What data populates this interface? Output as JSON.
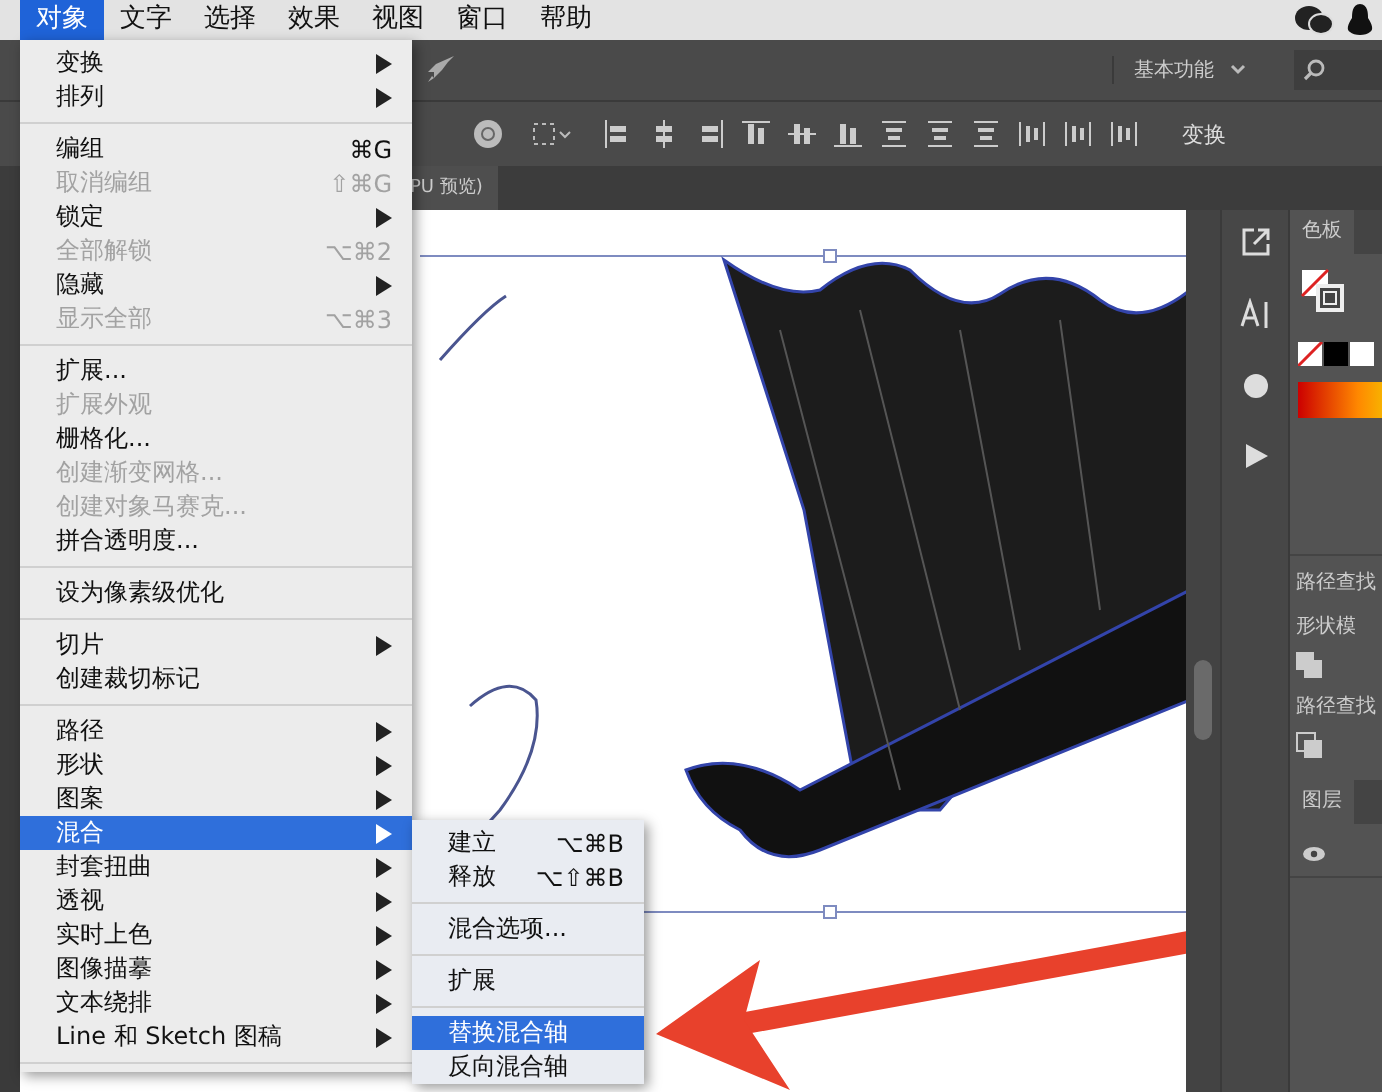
{
  "menubar": {
    "items": [
      {
        "label": "对象",
        "selected": true
      },
      {
        "label": "文字",
        "selected": false
      },
      {
        "label": "选择",
        "selected": false
      },
      {
        "label": "效果",
        "selected": false
      },
      {
        "label": "视图",
        "selected": false
      },
      {
        "label": "窗口",
        "selected": false
      },
      {
        "label": "帮助",
        "selected": false
      }
    ]
  },
  "menu": {
    "items": [
      {
        "kind": "item",
        "label": "变换",
        "submenu": true,
        "disabled": false,
        "selected": false
      },
      {
        "kind": "item",
        "label": "排列",
        "submenu": true,
        "disabled": false,
        "selected": false
      },
      {
        "kind": "separator"
      },
      {
        "kind": "item",
        "label": "编组",
        "shortcut": "⌘G",
        "submenu": false,
        "disabled": false,
        "selected": false
      },
      {
        "kind": "item",
        "label": "取消编组",
        "shortcut": "⇧⌘G",
        "submenu": false,
        "disabled": true,
        "selected": false
      },
      {
        "kind": "item",
        "label": "锁定",
        "submenu": true,
        "disabled": false,
        "selected": false
      },
      {
        "kind": "item",
        "label": "全部解锁",
        "shortcut": "⌥⌘2",
        "submenu": false,
        "disabled": true,
        "selected": false
      },
      {
        "kind": "item",
        "label": "隐藏",
        "submenu": true,
        "disabled": false,
        "selected": false
      },
      {
        "kind": "item",
        "label": "显示全部",
        "shortcut": "⌥⌘3",
        "submenu": false,
        "disabled": true,
        "selected": false
      },
      {
        "kind": "separator"
      },
      {
        "kind": "item",
        "label": "扩展...",
        "submenu": false,
        "disabled": false,
        "selected": false
      },
      {
        "kind": "item",
        "label": "扩展外观",
        "submenu": false,
        "disabled": true,
        "selected": false
      },
      {
        "kind": "item",
        "label": "栅格化...",
        "submenu": false,
        "disabled": false,
        "selected": false
      },
      {
        "kind": "item",
        "label": "创建渐变网格...",
        "submenu": false,
        "disabled": true,
        "selected": false
      },
      {
        "kind": "item",
        "label": "创建对象马赛克...",
        "submenu": false,
        "disabled": true,
        "selected": false
      },
      {
        "kind": "item",
        "label": "拼合透明度...",
        "submenu": false,
        "disabled": false,
        "selected": false
      },
      {
        "kind": "separator"
      },
      {
        "kind": "item",
        "label": "设为像素级优化",
        "submenu": false,
        "disabled": false,
        "selected": false
      },
      {
        "kind": "separator"
      },
      {
        "kind": "item",
        "label": "切片",
        "submenu": true,
        "disabled": false,
        "selected": false
      },
      {
        "kind": "item",
        "label": "创建裁切标记",
        "submenu": false,
        "disabled": false,
        "selected": false
      },
      {
        "kind": "separator"
      },
      {
        "kind": "item",
        "label": "路径",
        "submenu": true,
        "disabled": false,
        "selected": false
      },
      {
        "kind": "item",
        "label": "形状",
        "submenu": true,
        "disabled": false,
        "selected": false
      },
      {
        "kind": "item",
        "label": "图案",
        "submenu": true,
        "disabled": false,
        "selected": false
      },
      {
        "kind": "item",
        "label": "混合",
        "submenu": true,
        "disabled": false,
        "selected": true
      },
      {
        "kind": "item",
        "label": "封套扭曲",
        "submenu": true,
        "disabled": false,
        "selected": false
      },
      {
        "kind": "item",
        "label": "透视",
        "submenu": true,
        "disabled": false,
        "selected": false
      },
      {
        "kind": "item",
        "label": "实时上色",
        "submenu": true,
        "disabled": false,
        "selected": false
      },
      {
        "kind": "item",
        "label": "图像描摹",
        "submenu": true,
        "disabled": false,
        "selected": false
      },
      {
        "kind": "item",
        "label": "文本绕排",
        "submenu": true,
        "disabled": false,
        "selected": false
      },
      {
        "kind": "item",
        "label": "Line 和 Sketch 图稿",
        "submenu": true,
        "disabled": false,
        "selected": false
      },
      {
        "kind": "separator"
      }
    ]
  },
  "submenu": {
    "items": [
      {
        "kind": "item",
        "label": "建立",
        "shortcut": "⌥⌘B",
        "selected": false
      },
      {
        "kind": "item",
        "label": "释放",
        "shortcut": "⌥⇧⌘B",
        "selected": false
      },
      {
        "kind": "separator"
      },
      {
        "kind": "item",
        "label": "混合选项...",
        "selected": false
      },
      {
        "kind": "separator"
      },
      {
        "kind": "item",
        "label": "扩展",
        "selected": false
      },
      {
        "kind": "separator"
      },
      {
        "kind": "item",
        "label": "替换混合轴",
        "selected": true
      },
      {
        "kind": "item",
        "label": "反向混合轴",
        "selected": false
      }
    ]
  },
  "control_bar": {
    "workspace": "基本功能",
    "transform": "变换"
  },
  "document_tab": "PU 预览)",
  "panels": {
    "swatches_tab": "色板",
    "pathfinder_title": "路径查找",
    "shape_modes": "形状模",
    "pathfinders": "路径查找",
    "layers_tab": "图层"
  }
}
